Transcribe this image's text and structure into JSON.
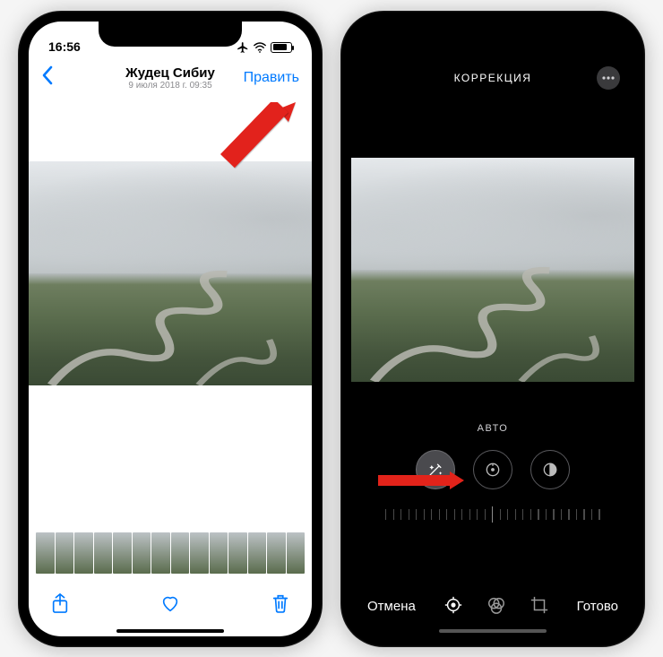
{
  "left": {
    "status_time": "16:56",
    "title": "Жудец Сибиу",
    "subtitle": "9 июля 2018 г.  09:35",
    "edit_label": "Править"
  },
  "right": {
    "header_title": "КОРРЕКЦИЯ",
    "adjust_label": "АВТО",
    "cancel_label": "Отмена",
    "done_label": "Готово"
  },
  "colors": {
    "ios_blue": "#007aff",
    "arrow": "#e2231a"
  }
}
